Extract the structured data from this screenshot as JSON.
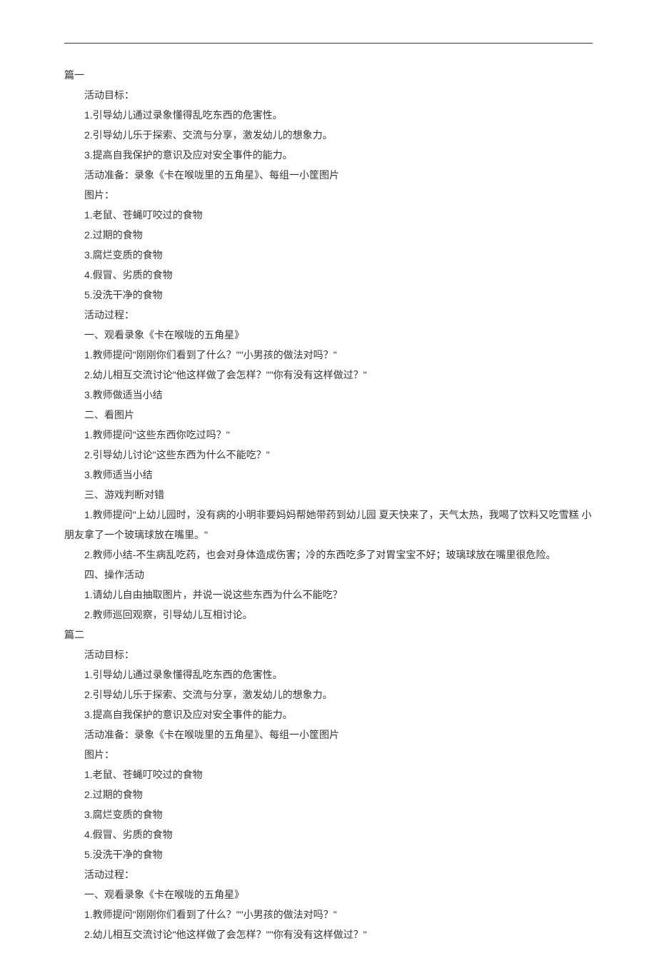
{
  "sections": [
    {
      "title": "篇一",
      "lines": [
        "活动目标：",
        "1.引导幼儿通过录象懂得乱吃东西的危害性。",
        "2.引导幼儿乐于探索、交流与分享，激发幼儿的想象力。",
        "3.提高自我保护的意识及应对安全事件的能力。",
        "活动准备：录象《卡在喉咙里的五角星》、每组一小筐图片",
        "图片：",
        "1.老鼠、苍蝇叮咬过的食物",
        "2.过期的食物",
        "3.腐烂变质的食物",
        "4.假冒、劣质的食物",
        "5.没洗干净的食物",
        "活动过程：",
        "一、观看录象《卡在喉咙的五角星》",
        "1.教师提问\"刚刚你们看到了什么？\"\"小男孩的做法对吗？\"",
        "2.幼儿相互交流讨论\"他这样做了会怎样？\"\"你有没有这样做过？\"",
        "3.教师做适当小结",
        "二、看图片",
        "1.教师提问\"这些东西你吃过吗？\"",
        "2.引导幼儿讨论\"这些东西为什么不能吃？\"",
        "3.教师适当小结",
        "三、游戏判断对错",
        "1.教师提问\"上幼儿园时，没有病的小明非要妈妈帮她带药到幼儿园 夏天快来了，天气太热，我喝了饮料又吃雪糕 小朋友拿了一个玻璃球放在嘴里。\"",
        "2.教师小结-不生病乱吃药，也会对身体造成伤害；冷的东西吃多了对胃宝宝不好；玻璃球放在嘴里很危险。",
        "四、操作活动",
        "1.请幼儿自由抽取图片，并说一说这些东西为什么不能吃？",
        "2.教师巡回观察，引导幼儿互相讨论。"
      ]
    },
    {
      "title": "篇二",
      "lines": [
        "活动目标：",
        "1.引导幼儿通过录象懂得乱吃东西的危害性。",
        "2.引导幼儿乐于探索、交流与分享，激发幼儿的想象力。",
        "3.提高自我保护的意识及应对安全事件的能力。",
        "活动准备：录象《卡在喉咙里的五角星》、每组一小筐图片",
        "图片：",
        "1.老鼠、苍蝇叮咬过的食物",
        "2.过期的食物",
        "3.腐烂变质的食物",
        "4.假冒、劣质的食物",
        "5.没洗干净的食物",
        "活动过程：",
        "一、观看录象《卡在喉咙的五角星》",
        "1.教师提问\"刚刚你们看到了什么？\"\"小男孩的做法对吗？\"",
        "2.幼儿相互交流讨论\"他这样做了会怎样？\"\"你有没有这样做过？\""
      ]
    }
  ]
}
